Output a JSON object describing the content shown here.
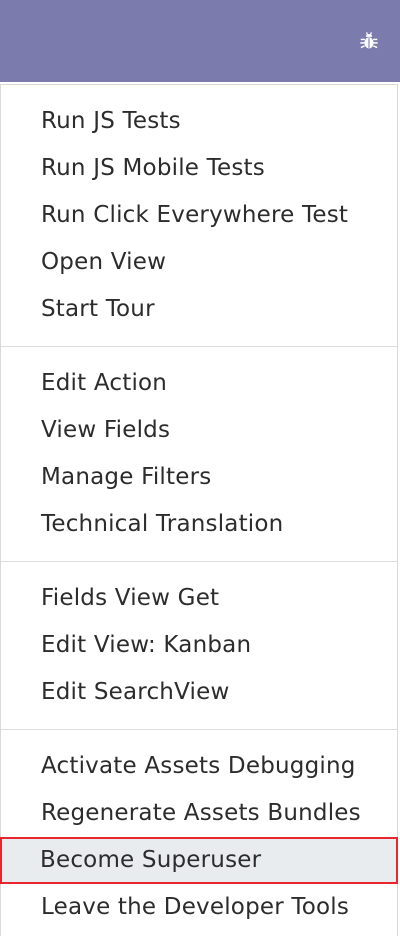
{
  "topbar": {
    "color": "#7c7bad",
    "debug_icon": "bug-icon"
  },
  "menu": {
    "groups": [
      {
        "items": [
          {
            "label": "Run JS Tests"
          },
          {
            "label": "Run JS Mobile Tests"
          },
          {
            "label": "Run Click Everywhere Test"
          },
          {
            "label": "Open View"
          },
          {
            "label": "Start Tour"
          }
        ]
      },
      {
        "items": [
          {
            "label": "Edit Action"
          },
          {
            "label": "View Fields"
          },
          {
            "label": "Manage Filters"
          },
          {
            "label": "Technical Translation"
          }
        ]
      },
      {
        "items": [
          {
            "label": "Fields View Get"
          },
          {
            "label": "Edit View: Kanban"
          },
          {
            "label": "Edit SearchView"
          }
        ]
      },
      {
        "items": [
          {
            "label": "Activate Assets Debugging"
          },
          {
            "label": "Regenerate Assets Bundles"
          },
          {
            "label": "Become Superuser",
            "highlighted": true
          },
          {
            "label": "Leave the Developer Tools"
          }
        ]
      }
    ],
    "highlight_color": "#e8262e"
  }
}
